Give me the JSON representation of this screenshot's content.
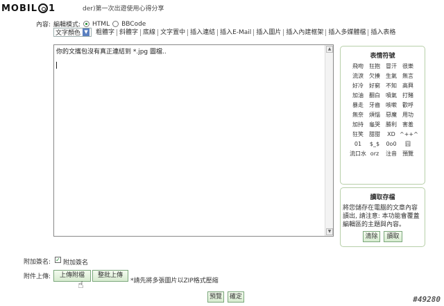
{
  "header": {
    "logo": "MOBILE01",
    "title_fragment": "der)第一次出遊使用心得分享"
  },
  "form": {
    "content_label": "內容:",
    "edit_mode_label": "編輯模式:",
    "mode_html": "HTML",
    "mode_bbcode": "BBCode",
    "selected_mode": "HTML"
  },
  "toolbar": {
    "color_select": "文字顏色",
    "items": [
      "粗體字",
      "斜體字",
      "底線",
      "文字置中",
      "插入連結",
      "插入E-Mail",
      "插入圖片",
      "插入內建框架",
      "插入多媒體檔",
      "插入表格"
    ]
  },
  "editor": {
    "value": "你的文攜包沒有真正連結到 *.jpg 圖檔.."
  },
  "emotes": {
    "title": "表情符號",
    "items": [
      "飛吻",
      "狂抱",
      "冒汗",
      "很樂",
      "流淚",
      "欠揍",
      "生氣",
      "無言",
      "好冷",
      "好窮",
      "不知",
      "高興",
      "加油",
      "翻白",
      "噴氣",
      "打賭",
      "暴走",
      "牙齒",
      "咳嗽",
      "歡呼",
      "無奈",
      "煩惱",
      "惡魔",
      "用功",
      "加持",
      "龜哭",
      "勝利",
      "害羞",
      "狂笑",
      "甜甜",
      "XD",
      "^++^",
      "01",
      "$_$",
      "0o0",
      "囧",
      "流口水",
      "orz",
      "注音",
      "預覽"
    ]
  },
  "draft": {
    "title": "讀取存檔",
    "description": "將您儲存在電腦的文章內容讀出, 請注意: 本功能會覆蓋編輯區的主題與內容。",
    "clear_button": "清除",
    "read_button": "讀取"
  },
  "signature": {
    "label": "附加簽名:",
    "checkbox_label": "附加簽名",
    "checked": true
  },
  "attachment": {
    "label": "附件上傳:",
    "upload_button": "上傳附檔",
    "batch_button": "整批上傳",
    "note": "*請先將多張圖片以ZIP格式壓縮"
  },
  "footer": {
    "preview_button": "預覽",
    "submit_button": "確定"
  },
  "watermark": "#49280",
  "colors": {
    "panel_border": "#b7cfa8",
    "button_border": "#7aa67a",
    "radio_on": "#1a8a2a"
  }
}
